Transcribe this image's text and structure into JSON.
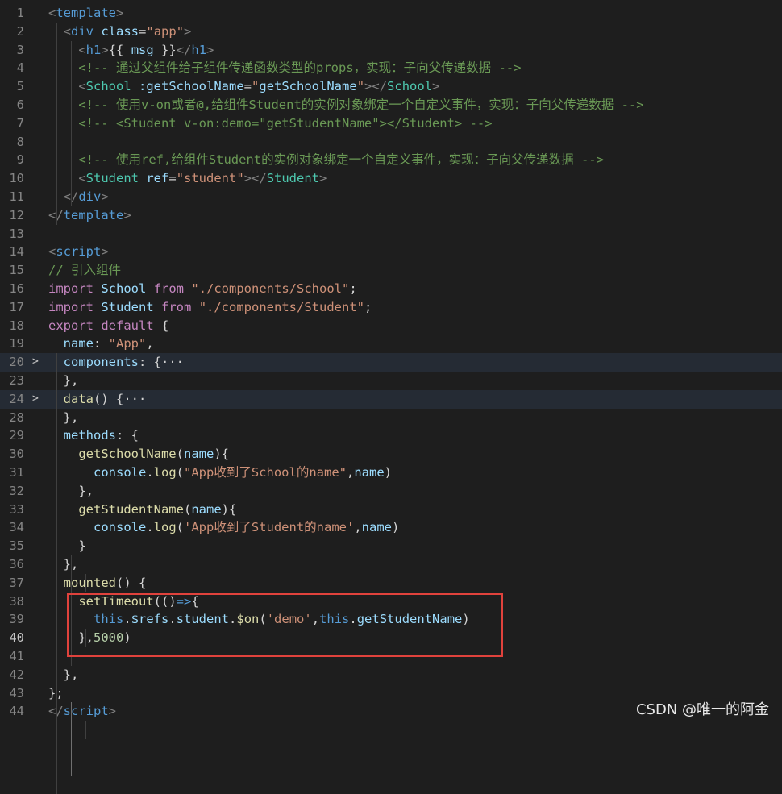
{
  "lines": [
    {
      "n": "1",
      "parts": [
        [
          "t-punc",
          "<"
        ],
        [
          "t-tag",
          "template"
        ],
        [
          "t-punc",
          ">"
        ]
      ]
    },
    {
      "n": "2",
      "parts": [
        [
          "t-plain",
          "  "
        ],
        [
          "t-punc",
          "<"
        ],
        [
          "t-tag",
          "div"
        ],
        [
          "t-plain",
          " "
        ],
        [
          "t-attr",
          "class"
        ],
        [
          "t-plain",
          "="
        ],
        [
          "t-str",
          "\"app\""
        ],
        [
          "t-punc",
          ">"
        ]
      ]
    },
    {
      "n": "3",
      "parts": [
        [
          "t-plain",
          "    "
        ],
        [
          "t-punc",
          "<"
        ],
        [
          "t-tag",
          "h1"
        ],
        [
          "t-punc",
          ">"
        ],
        [
          "t-plain",
          "{{ "
        ],
        [
          "t-var",
          "msg"
        ],
        [
          "t-plain",
          " }}"
        ],
        [
          "t-punc",
          "</"
        ],
        [
          "t-tag",
          "h1"
        ],
        [
          "t-punc",
          ">"
        ]
      ]
    },
    {
      "n": "4",
      "parts": [
        [
          "t-plain",
          "    "
        ],
        [
          "t-com",
          "<!-- 通过父组件给子组件传递函数类型的props，实现：子向父传递数据 -->"
        ]
      ]
    },
    {
      "n": "5",
      "parts": [
        [
          "t-plain",
          "    "
        ],
        [
          "t-punc",
          "<"
        ],
        [
          "t-cls",
          "School"
        ],
        [
          "t-plain",
          " "
        ],
        [
          "t-attr",
          ":getSchoolName"
        ],
        [
          "t-plain",
          "="
        ],
        [
          "t-str",
          "\""
        ],
        [
          "t-var",
          "getSchoolName"
        ],
        [
          "t-str",
          "\""
        ],
        [
          "t-punc",
          "></"
        ],
        [
          "t-cls",
          "School"
        ],
        [
          "t-punc",
          ">"
        ]
      ]
    },
    {
      "n": "6",
      "parts": [
        [
          "t-plain",
          "    "
        ],
        [
          "t-com",
          "<!-- 使用v-on或者@,给组件Student的实例对象绑定一个自定义事件，实现：子向父传递数据 -->"
        ]
      ]
    },
    {
      "n": "7",
      "parts": [
        [
          "t-plain",
          "    "
        ],
        [
          "t-com",
          "<!-- <Student v-on:demo=\"getStudentName\"></Student> -->"
        ]
      ]
    },
    {
      "n": "8",
      "parts": []
    },
    {
      "n": "9",
      "parts": [
        [
          "t-plain",
          "    "
        ],
        [
          "t-com",
          "<!-- 使用ref,给组件Student的实例对象绑定一个自定义事件，实现：子向父传递数据 -->"
        ]
      ]
    },
    {
      "n": "10",
      "parts": [
        [
          "t-plain",
          "    "
        ],
        [
          "t-punc",
          "<"
        ],
        [
          "t-cls",
          "Student"
        ],
        [
          "t-plain",
          " "
        ],
        [
          "t-attr",
          "ref"
        ],
        [
          "t-plain",
          "="
        ],
        [
          "t-str",
          "\"student\""
        ],
        [
          "t-punc",
          "></"
        ],
        [
          "t-cls",
          "Student"
        ],
        [
          "t-punc",
          ">"
        ]
      ]
    },
    {
      "n": "11",
      "parts": [
        [
          "t-plain",
          "  "
        ],
        [
          "t-punc",
          "</"
        ],
        [
          "t-tag",
          "div"
        ],
        [
          "t-punc",
          ">"
        ]
      ]
    },
    {
      "n": "12",
      "parts": [
        [
          "t-punc",
          "</"
        ],
        [
          "t-tag",
          "template"
        ],
        [
          "t-punc",
          ">"
        ]
      ]
    },
    {
      "n": "13",
      "parts": []
    },
    {
      "n": "14",
      "parts": [
        [
          "t-punc",
          "<"
        ],
        [
          "t-tag",
          "script"
        ],
        [
          "t-punc",
          ">"
        ]
      ]
    },
    {
      "n": "15",
      "parts": [
        [
          "t-com",
          "// 引入组件"
        ]
      ]
    },
    {
      "n": "16",
      "parts": [
        [
          "t-kw",
          "import"
        ],
        [
          "t-plain",
          " "
        ],
        [
          "t-var",
          "School"
        ],
        [
          "t-plain",
          " "
        ],
        [
          "t-kw",
          "from"
        ],
        [
          "t-plain",
          " "
        ],
        [
          "t-str",
          "\"./components/School\""
        ],
        [
          "t-plain",
          ";"
        ]
      ]
    },
    {
      "n": "17",
      "parts": [
        [
          "t-kw",
          "import"
        ],
        [
          "t-plain",
          " "
        ],
        [
          "t-var",
          "Student"
        ],
        [
          "t-plain",
          " "
        ],
        [
          "t-kw",
          "from"
        ],
        [
          "t-plain",
          " "
        ],
        [
          "t-str",
          "\"./components/Student\""
        ],
        [
          "t-plain",
          ";"
        ]
      ]
    },
    {
      "n": "18",
      "parts": [
        [
          "t-kw",
          "export"
        ],
        [
          "t-plain",
          " "
        ],
        [
          "t-kw",
          "default"
        ],
        [
          "t-plain",
          " {"
        ]
      ]
    },
    {
      "n": "19",
      "parts": [
        [
          "t-plain",
          "  "
        ],
        [
          "t-var",
          "name"
        ],
        [
          "t-plain",
          ": "
        ],
        [
          "t-str",
          "\"App\""
        ],
        [
          "t-plain",
          ","
        ]
      ]
    },
    {
      "n": "20",
      "fold": ">",
      "folded": true,
      "parts": [
        [
          "t-plain",
          "  "
        ],
        [
          "t-var",
          "components"
        ],
        [
          "t-plain",
          ": {"
        ],
        [
          "t-fold",
          "···"
        ]
      ]
    },
    {
      "n": "23",
      "parts": [
        [
          "t-plain",
          "  },"
        ]
      ]
    },
    {
      "n": "24",
      "fold": ">",
      "folded": true,
      "parts": [
        [
          "t-plain",
          "  "
        ],
        [
          "t-fn",
          "data"
        ],
        [
          "t-plain",
          "() {"
        ],
        [
          "t-fold",
          "···"
        ]
      ]
    },
    {
      "n": "28",
      "parts": [
        [
          "t-plain",
          "  },"
        ]
      ]
    },
    {
      "n": "29",
      "parts": [
        [
          "t-plain",
          "  "
        ],
        [
          "t-var",
          "methods"
        ],
        [
          "t-plain",
          ": {"
        ]
      ]
    },
    {
      "n": "30",
      "parts": [
        [
          "t-plain",
          "    "
        ],
        [
          "t-fn",
          "getSchoolName"
        ],
        [
          "t-plain",
          "("
        ],
        [
          "t-var",
          "name"
        ],
        [
          "t-plain",
          "){"
        ]
      ]
    },
    {
      "n": "31",
      "parts": [
        [
          "t-plain",
          "      "
        ],
        [
          "t-var",
          "console"
        ],
        [
          "t-plain",
          "."
        ],
        [
          "t-fn",
          "log"
        ],
        [
          "t-plain",
          "("
        ],
        [
          "t-str",
          "\"App收到了School的name\""
        ],
        [
          "t-plain",
          ","
        ],
        [
          "t-var",
          "name"
        ],
        [
          "t-plain",
          ")"
        ]
      ]
    },
    {
      "n": "32",
      "parts": [
        [
          "t-plain",
          "    },"
        ]
      ]
    },
    {
      "n": "33",
      "parts": [
        [
          "t-plain",
          "    "
        ],
        [
          "t-fn",
          "getStudentName"
        ],
        [
          "t-plain",
          "("
        ],
        [
          "t-var",
          "name"
        ],
        [
          "t-plain",
          "){"
        ]
      ]
    },
    {
      "n": "34",
      "parts": [
        [
          "t-plain",
          "      "
        ],
        [
          "t-var",
          "console"
        ],
        [
          "t-plain",
          "."
        ],
        [
          "t-fn",
          "log"
        ],
        [
          "t-plain",
          "("
        ],
        [
          "t-str",
          "'App收到了Student的name'"
        ],
        [
          "t-plain",
          ","
        ],
        [
          "t-var",
          "name"
        ],
        [
          "t-plain",
          ")"
        ]
      ]
    },
    {
      "n": "35",
      "parts": [
        [
          "t-plain",
          "    }"
        ]
      ]
    },
    {
      "n": "36",
      "parts": [
        [
          "t-plain",
          "  },"
        ]
      ]
    },
    {
      "n": "37",
      "parts": [
        [
          "t-plain",
          "  "
        ],
        [
          "t-fn",
          "mounted"
        ],
        [
          "t-plain",
          "() {"
        ]
      ]
    },
    {
      "n": "38",
      "parts": [
        [
          "t-plain",
          "    "
        ],
        [
          "t-fn",
          "setTimeout"
        ],
        [
          "t-plain",
          "(()"
        ],
        [
          "t-kwb",
          "=>"
        ],
        [
          "t-plain",
          "{"
        ]
      ]
    },
    {
      "n": "39",
      "parts": [
        [
          "t-plain",
          "      "
        ],
        [
          "t-kwb",
          "this"
        ],
        [
          "t-plain",
          "."
        ],
        [
          "t-var",
          "$refs"
        ],
        [
          "t-plain",
          "."
        ],
        [
          "t-var",
          "student"
        ],
        [
          "t-plain",
          "."
        ],
        [
          "t-fn",
          "$on"
        ],
        [
          "t-plain",
          "("
        ],
        [
          "t-str",
          "'demo'"
        ],
        [
          "t-plain",
          ","
        ],
        [
          "t-kwb",
          "this"
        ],
        [
          "t-plain",
          "."
        ],
        [
          "t-var",
          "getStudentName"
        ],
        [
          "t-plain",
          ")"
        ]
      ]
    },
    {
      "n": "40",
      "current": true,
      "parts": [
        [
          "t-plain",
          "    },"
        ],
        [
          "t-num",
          "5000"
        ],
        [
          "t-plain",
          ")"
        ]
      ]
    },
    {
      "n": "41",
      "parts": []
    },
    {
      "n": "42",
      "parts": [
        [
          "t-plain",
          "  },"
        ]
      ]
    },
    {
      "n": "43",
      "parts": [
        [
          "t-plain",
          "};"
        ]
      ]
    },
    {
      "n": "44",
      "parts": [
        [
          "t-punc",
          "</"
        ],
        [
          "t-tag",
          "script"
        ],
        [
          "t-punc",
          ">"
        ]
      ]
    }
  ],
  "watermark": "CSDN @唯一的阿金",
  "colors": {
    "background": "#1e1e1e",
    "highlight_box": "#e0423c"
  }
}
